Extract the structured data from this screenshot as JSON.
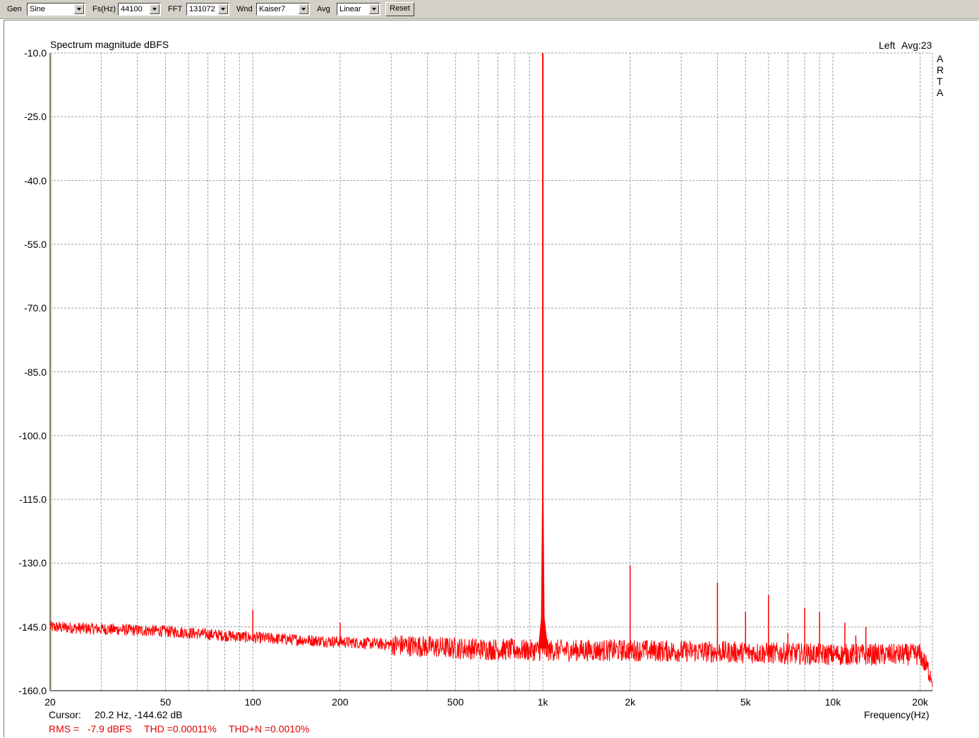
{
  "toolbar": {
    "gen_label": "Gen",
    "gen_value": "Sine",
    "fs_label": "Fs(Hz)",
    "fs_value": "44100",
    "fft_label": "FFT",
    "fft_value": "131072",
    "wnd_label": "Wnd",
    "wnd_value": "Kaiser7",
    "avg_label": "Avg",
    "avg_value": "Linear",
    "reset_label": "Reset"
  },
  "plot": {
    "title": "Spectrum magnitude dBFS",
    "channel": "Left",
    "avg": "Avg:23",
    "brand": [
      "A",
      "R",
      "T",
      "A"
    ],
    "cursor_label": "Cursor:",
    "cursor_value": "20.2 Hz, -144.62 dB",
    "rms": "RMS =   -7.9 dBFS",
    "thd": "THD =0.00011%",
    "thdn": "THD+N =0.0010%",
    "xaxis_label": "Frequency(Hz)"
  },
  "colors": {
    "trace": "#ff0000",
    "grid": "#a0a0a0",
    "marker": "#e8d000",
    "background": "#ffffff",
    "toolbar": "#d4d0c8"
  },
  "chart_data": {
    "type": "line",
    "title": "Spectrum magnitude dBFS",
    "xlabel": "Frequency(Hz)",
    "ylabel": "",
    "xscale": "log",
    "xlim": [
      20,
      22050
    ],
    "ylim": [
      -160,
      -10
    ],
    "grid": true,
    "yticks": [
      -10,
      -25,
      -40,
      -55,
      -70,
      -85,
      -100,
      -115,
      -130,
      -145,
      -160
    ],
    "ytick_labels": [
      "-10.0",
      "-25.0",
      "-40.0",
      "-55.0",
      "-70.0",
      "-85.0",
      "-100.0",
      "-115.0",
      "-130.0",
      "-145.0",
      "-160.0"
    ],
    "xtick_values": [
      20,
      50,
      100,
      200,
      500,
      1000,
      2000,
      5000,
      10000,
      20000
    ],
    "xtick_labels": [
      "20",
      "50",
      "100",
      "200",
      "500",
      "1k",
      "2k",
      "5k",
      "10k",
      "20k"
    ],
    "series": [
      {
        "noise_floor": {
          "x": [
            20,
            30,
            50,
            100,
            200,
            500,
            900,
            1100,
            2000,
            5000,
            10000,
            20000,
            22050
          ],
          "y": [
            -145,
            -145.5,
            -146,
            -147.5,
            -148.5,
            -150,
            -150.5,
            -150.5,
            -150.5,
            -151,
            -151.5,
            -151.5,
            -157
          ]
        },
        "peaks": [
          {
            "x": 1000,
            "y": -10
          },
          {
            "x": 100,
            "y": -141
          },
          {
            "x": 200,
            "y": -144
          },
          {
            "x": 2000,
            "y": -130.5
          },
          {
            "x": 4000,
            "y": -134.5
          },
          {
            "x": 5000,
            "y": -141.5
          },
          {
            "x": 6000,
            "y": -137.5
          },
          {
            "x": 7000,
            "y": -146.5
          },
          {
            "x": 8000,
            "y": -140.5
          },
          {
            "x": 9000,
            "y": -141.5
          },
          {
            "x": 11000,
            "y": -144
          },
          {
            "x": 12000,
            "y": -147
          },
          {
            "x": 13000,
            "y": -145
          }
        ]
      }
    ]
  }
}
